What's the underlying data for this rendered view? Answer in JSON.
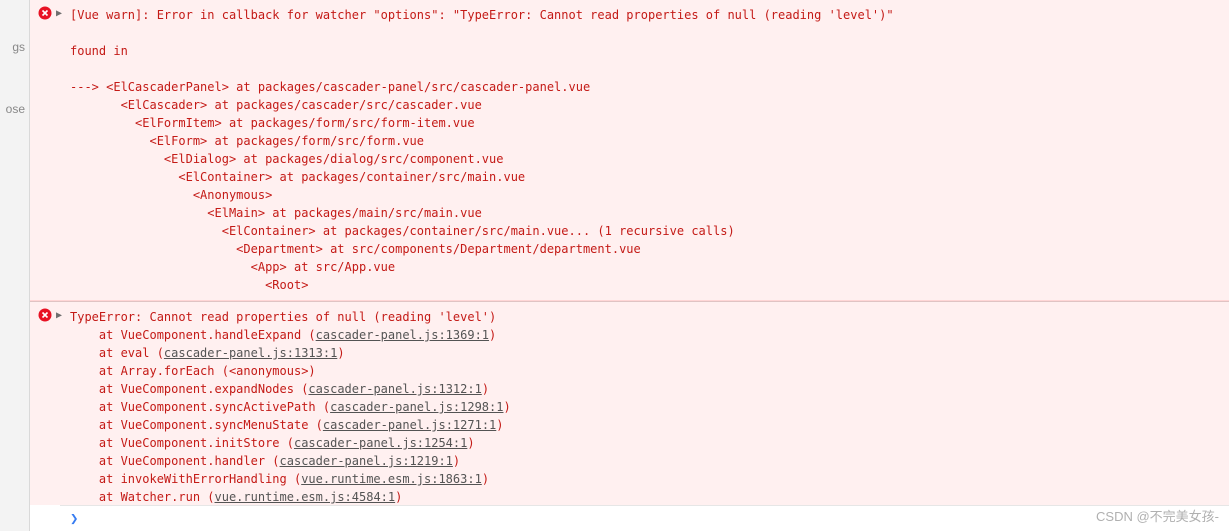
{
  "sidebar": {
    "items": [
      "gs",
      "ose"
    ]
  },
  "error1": {
    "header": "[Vue warn]: Error in callback for watcher \"options\": \"TypeError: Cannot read properties of null (reading 'level')\"",
    "found_in": "found in",
    "tree": "---> <ElCascaderPanel> at packages/cascader-panel/src/cascader-panel.vue\n       <ElCascader> at packages/cascader/src/cascader.vue\n         <ElFormItem> at packages/form/src/form-item.vue\n           <ElForm> at packages/form/src/form.vue\n             <ElDialog> at packages/dialog/src/component.vue\n               <ElContainer> at packages/container/src/main.vue\n                 <Anonymous>\n                   <ElMain> at packages/main/src/main.vue\n                     <ElContainer> at packages/container/src/main.vue... (1 recursive calls)\n                       <Department> at src/components/Department/department.vue\n                         <App> at src/App.vue\n                           <Root>"
  },
  "error2": {
    "header": "TypeError: Cannot read properties of null (reading 'level')",
    "stack": [
      {
        "prefix": "    at VueComponent.handleExpand (",
        "link": "cascader-panel.js:1369:1",
        "suffix": ")"
      },
      {
        "prefix": "    at eval (",
        "link": "cascader-panel.js:1313:1",
        "suffix": ")"
      },
      {
        "prefix": "    at Array.forEach (<anonymous>)",
        "link": "",
        "suffix": ""
      },
      {
        "prefix": "    at VueComponent.expandNodes (",
        "link": "cascader-panel.js:1312:1",
        "suffix": ")"
      },
      {
        "prefix": "    at VueComponent.syncActivePath (",
        "link": "cascader-panel.js:1298:1",
        "suffix": ")"
      },
      {
        "prefix": "    at VueComponent.syncMenuState (",
        "link": "cascader-panel.js:1271:1",
        "suffix": ")"
      },
      {
        "prefix": "    at VueComponent.initStore (",
        "link": "cascader-panel.js:1254:1",
        "suffix": ")"
      },
      {
        "prefix": "    at VueComponent.handler (",
        "link": "cascader-panel.js:1219:1",
        "suffix": ")"
      },
      {
        "prefix": "    at invokeWithErrorHandling (",
        "link": "vue.runtime.esm.js:1863:1",
        "suffix": ")"
      },
      {
        "prefix": "    at Watcher.run (",
        "link": "vue.runtime.esm.js:4584:1",
        "suffix": ")"
      }
    ]
  },
  "prompt": "❯",
  "watermark": "CSDN @不完美女孩-"
}
